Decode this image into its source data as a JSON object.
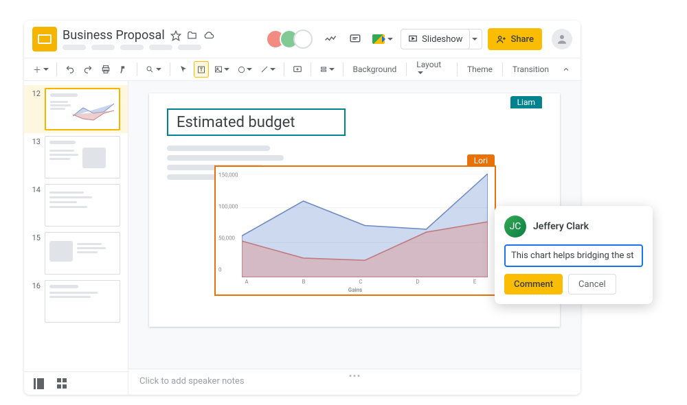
{
  "doc": {
    "title": "Business Proposal"
  },
  "header": {
    "slideshow_label": "Slideshow",
    "share_label": "Share"
  },
  "toolbar": {
    "background": "Background",
    "layout": "Layout",
    "theme": "Theme",
    "transition": "Transition"
  },
  "thumbs": [
    "12",
    "13",
    "14",
    "15",
    "16"
  ],
  "slide": {
    "title": "Estimated budget",
    "collab1": "Liam",
    "collab2": "Lori"
  },
  "notes_placeholder": "Click to add speaker notes",
  "comment": {
    "author": "Jeffery Clark",
    "draft": "This chart helps bridging the st",
    "submit": "Comment",
    "cancel": "Cancel"
  },
  "chart_data": {
    "type": "area",
    "xlabel": "Gains",
    "categories": [
      "A",
      "B",
      "C",
      "D",
      "E"
    ],
    "ylim": [
      0,
      150000
    ],
    "yticks": [
      0,
      50000,
      100000,
      150000
    ],
    "series": [
      {
        "name": "blue",
        "color": "#a3b9e0",
        "values": [
          60000,
          110000,
          75000,
          70000,
          150000
        ]
      },
      {
        "name": "red",
        "color": "#d9a0a3",
        "values": [
          52000,
          28000,
          25000,
          65000,
          80000
        ]
      }
    ]
  }
}
